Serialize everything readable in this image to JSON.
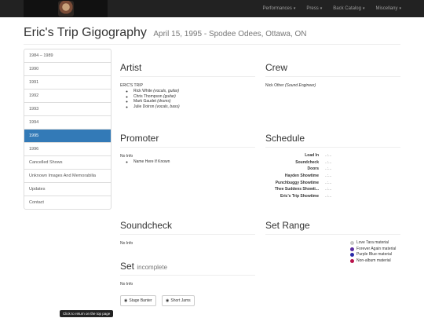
{
  "nav": {
    "items": [
      {
        "label": "Performances"
      },
      {
        "label": "Press"
      },
      {
        "label": "Back Catalog"
      },
      {
        "label": "Miscellany"
      }
    ]
  },
  "page": {
    "title": "Eric's Trip Gigography",
    "subtitle": "April 15, 1995 - Spodee Odees, Ottawa, ON"
  },
  "sidebar": {
    "items": [
      {
        "label": "1984 – 1989"
      },
      {
        "label": "1990"
      },
      {
        "label": "1991"
      },
      {
        "label": "1992"
      },
      {
        "label": "1993"
      },
      {
        "label": "1994"
      },
      {
        "label": "1995",
        "active": true
      },
      {
        "label": "1996"
      },
      {
        "label": "Cancelled Shows"
      },
      {
        "label": "Unknown Images And Memorabilia"
      },
      {
        "label": "Updates"
      },
      {
        "label": "Contact"
      }
    ]
  },
  "artist": {
    "heading": "Artist",
    "band": "ERIC'S TRIP",
    "members": [
      {
        "name": "Rick White",
        "role": "(vocals, guitar)"
      },
      {
        "name": "Chris Thompson",
        "role": "(guitar)"
      },
      {
        "name": "Mark Gaudet",
        "role": "(drums)"
      },
      {
        "name": "Julie Doiron",
        "role": "(vocals, bass)"
      }
    ]
  },
  "crew": {
    "heading": "Crew",
    "name": "Nick Other",
    "role": "(Sound Engineer)"
  },
  "promoter": {
    "heading": "Promoter",
    "info": "No Info",
    "items": [
      "Name Here If Known"
    ]
  },
  "schedule": {
    "heading": "Schedule",
    "rows": [
      {
        "label": "Load In",
        "value": "..:..."
      },
      {
        "label": "Soundcheck",
        "value": "..:..."
      },
      {
        "label": "Doors",
        "value": "..:..."
      },
      {
        "label": "Hayden Showtime",
        "value": "..:..."
      },
      {
        "label": "Punchbuggy Showtime",
        "value": "..:..."
      },
      {
        "label": "Thee Suddens Showti...",
        "value": "..:..."
      },
      {
        "label": "Eric's Trip Showtime",
        "value": "..:..."
      }
    ]
  },
  "soundcheck": {
    "heading": "Soundcheck",
    "info": "No Info"
  },
  "setrange": {
    "heading": "Set Range",
    "legend": [
      {
        "label": "Love Tara material",
        "color": "#c8c8c8"
      },
      {
        "label": "Forever Again material",
        "color": "#5b2da0"
      },
      {
        "label": "Purple Blue material",
        "color": "#2a2aa8"
      },
      {
        "label": "Non-album material",
        "color": "#b8124a"
      }
    ]
  },
  "set": {
    "heading": "Set",
    "status": "incomplete",
    "info": "No Info",
    "buttons": [
      {
        "label": "Stage Banter",
        "icon": "eye-icon"
      },
      {
        "label": "Short Jams",
        "icon": "eye-icon"
      }
    ]
  },
  "footer": {
    "toplink": "Click to return on the top page"
  }
}
